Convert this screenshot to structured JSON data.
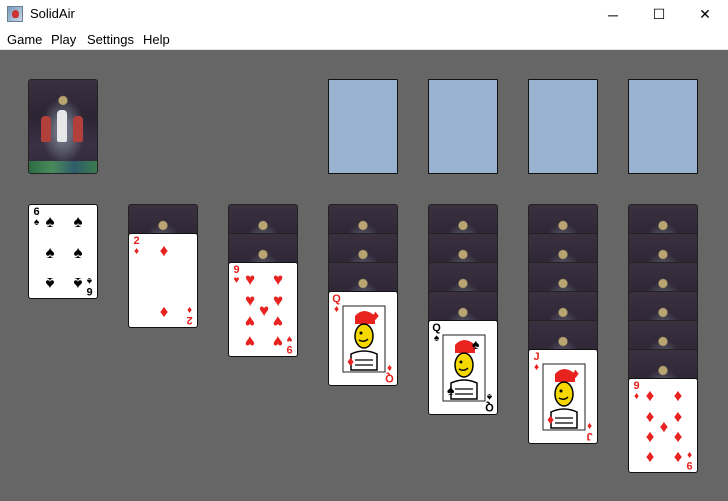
{
  "window": {
    "title": "SolidAir",
    "controls": {
      "minimize": "─",
      "maximize": "☐",
      "close": "✕"
    }
  },
  "menu": [
    "Game",
    "Play",
    "Settings",
    "Help"
  ],
  "colors": {
    "table": "#666666",
    "empty_slot": "#98b2cf",
    "red_suit": "#e8221f"
  },
  "stock": {
    "face": "down"
  },
  "foundations": [
    {
      "state": "empty"
    },
    {
      "state": "empty"
    },
    {
      "state": "empty"
    },
    {
      "state": "empty"
    }
  ],
  "tableau": [
    {
      "hidden": 0,
      "top": {
        "rank": "6",
        "suit": "♠",
        "color": "black"
      }
    },
    {
      "hidden": 1,
      "top": {
        "rank": "2",
        "suit": "♦",
        "color": "red"
      }
    },
    {
      "hidden": 2,
      "top": {
        "rank": "9",
        "suit": "♥",
        "color": "red"
      }
    },
    {
      "hidden": 3,
      "top": {
        "rank": "Q",
        "suit": "♦",
        "color": "red"
      }
    },
    {
      "hidden": 4,
      "top": {
        "rank": "Q",
        "suit": "♠",
        "color": "black"
      }
    },
    {
      "hidden": 5,
      "top": {
        "rank": "J",
        "suit": "♦",
        "color": "red"
      }
    },
    {
      "hidden": 6,
      "top": {
        "rank": "9",
        "suit": "♦",
        "color": "red"
      }
    }
  ]
}
